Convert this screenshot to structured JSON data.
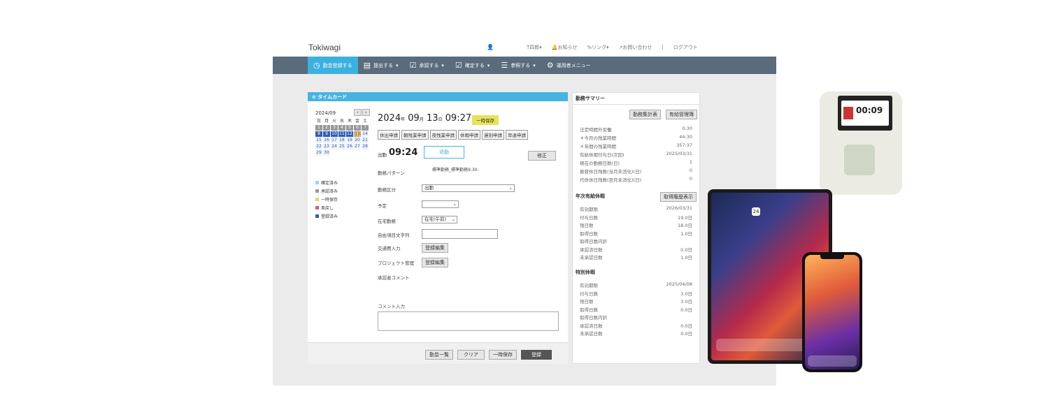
{
  "header": {
    "logo": "Tokiwagi",
    "user": "T四郎",
    "notice": "お知らせ",
    "links": "リンク",
    "contact": "お問い合わせ",
    "logout": "ログアウト"
  },
  "nav": [
    {
      "label": "勤怠登録する",
      "icon": "clock-icon"
    },
    {
      "label": "提出する",
      "icon": "document-icon"
    },
    {
      "label": "承認する",
      "icon": "check-icon"
    },
    {
      "label": "確定する",
      "icon": "check-icon"
    },
    {
      "label": "参照する",
      "icon": "list-icon"
    },
    {
      "label": "運用者メニュー",
      "icon": "gear-icon"
    }
  ],
  "timecard": {
    "title": "タイムカード",
    "month": "2024/09",
    "weekdays": [
      "日",
      "月",
      "火",
      "水",
      "木",
      "金",
      "土"
    ],
    "date_year": "2024",
    "date_month": "09",
    "date_day": "13",
    "time": "09:27",
    "status_badge": "一時保存",
    "requests": [
      "休出申請",
      "朝残業申請",
      "夜残業申請",
      "休暇申請",
      "遅刻申請",
      "早退申請"
    ],
    "in_label": "出勤",
    "in_time": "09:24",
    "out_button": "退勤",
    "fix_button": "修正",
    "pattern_label": "勤務パターン",
    "pattern_value": "標準勤務_標準勤務9:30-",
    "kubun_label": "勤務区分",
    "kubun_value": "出勤",
    "place_label": "予定",
    "shift_label": "在宅勤務",
    "shift_value": "在宅(午前)",
    "free_label": "自由項目文字列",
    "expense_label": "交通費入力",
    "expense_btn": "登録編集",
    "project_label": "プロジェクト管理",
    "project_btn": "登録編集",
    "approver_label": "承認者コメント",
    "comment_label": "コメント入力",
    "footer": [
      "勤怠一覧",
      "クリア",
      "一時保存",
      "登録"
    ]
  },
  "legend": [
    {
      "label": "確定済み",
      "color": "#9fd2ef"
    },
    {
      "label": "承認済み",
      "color": "#999999"
    },
    {
      "label": "一時保存",
      "color": "#f0d45b"
    },
    {
      "label": "差戻し",
      "color": "#e05a6a"
    },
    {
      "label": "登録済み",
      "color": "#2f5fb5"
    }
  ],
  "summary": {
    "title": "勤務サマリー",
    "btn1": "勤務集計表",
    "btn2": "有給管理簿",
    "rows": [
      [
        "法定時間外労働",
        "0:30"
      ],
      [
        "＊今月の残業時間",
        "44:30"
      ],
      [
        "＊年間の残業時間",
        "357:37"
      ],
      [
        "有給休暇付与日(次回)",
        "2025/03/31"
      ],
      [
        "現在の勤務日数(日)",
        "1"
      ],
      [
        "振替休日残数(当月未消化)(日)",
        "0"
      ],
      [
        "代休休日残数(翌月未消化)(日)",
        "0"
      ]
    ],
    "annual_title": "年次有給休暇",
    "annual_btn": "取得履歴表示",
    "annual_rows": [
      [
        "有効期限",
        "2026/03/31"
      ],
      [
        "付与日数",
        "19.0日"
      ],
      [
        "残日数",
        "18.0日"
      ],
      [
        "取得日数",
        "1.0日"
      ],
      [
        "取得日数内訳",
        ""
      ],
      [
        "承認済日数",
        "0.0日"
      ],
      [
        "未承認日数",
        "1.0日"
      ]
    ],
    "special_title": "特別休暇",
    "special_rows": [
      [
        "有効期限",
        "2025/04/08"
      ],
      [
        "付与日数",
        "3.0日"
      ],
      [
        "残日数",
        "3.0日"
      ],
      [
        "取得日数",
        "0.0日"
      ],
      [
        "取得日数内訳",
        ""
      ],
      [
        "承認済日数",
        "0.0日"
      ],
      [
        "未承認日数",
        "0.0日"
      ]
    ]
  },
  "devices": {
    "clock_time": "00:09",
    "tablet_date": "24"
  },
  "colors": {
    "nav_bg": "#5a6b7b",
    "accent": "#3cb1e0"
  }
}
